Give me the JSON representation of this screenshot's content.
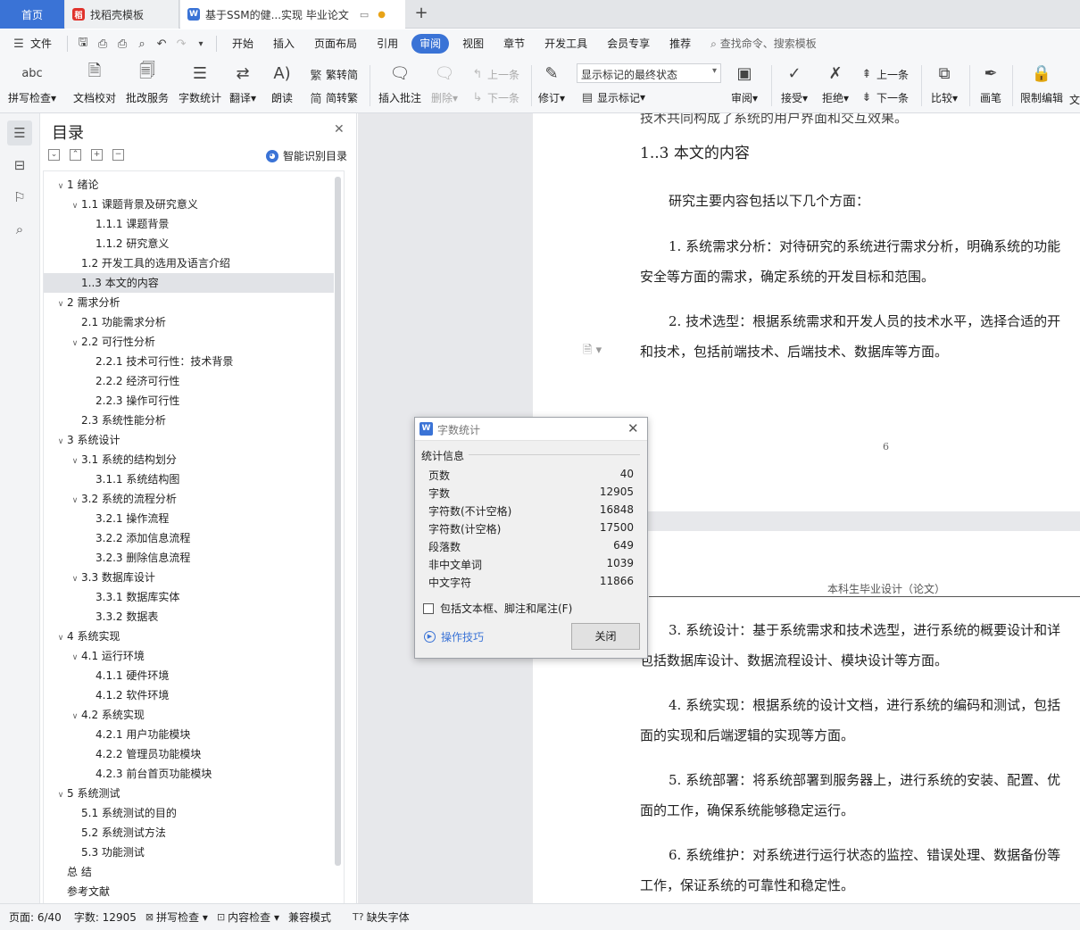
{
  "tabs": {
    "home": "首页",
    "template": "找稻壳模板",
    "document": "基于SSM的健...实现 毕业论文",
    "add": "+"
  },
  "menubar": {
    "file": "文件",
    "items": [
      "开始",
      "插入",
      "页面布局",
      "引用",
      "审阅",
      "视图",
      "章节",
      "开发工具",
      "会员专享",
      "推荐"
    ],
    "search": "查找命令、搜索模板"
  },
  "ribbon": {
    "spell_check": "拼写检查",
    "doc_proof": "文档校对",
    "batch_service": "批改服务",
    "word_count": "字数统计",
    "translate": "翻译",
    "read_aloud": "朗读",
    "trad_to_simp": "繁转简",
    "simp_to_trad": "简转繁",
    "insert_comment": "插入批注",
    "delete": "删除",
    "prev_comment": "上一条",
    "next_comment": "下一条",
    "track_changes": "修订",
    "markup_mode": "显示标记的最终状态",
    "show_markup": "显示标记",
    "review": "审阅",
    "accept": "接受",
    "reject": "拒绝",
    "prev_change": "上一条",
    "next_change": "下一条",
    "compare": "比较",
    "ink": "画笔",
    "restrict_editing": "限制编辑",
    "document_cut": "文"
  },
  "toc": {
    "title": "目录",
    "smart": "智能识别目录",
    "items": [
      {
        "label": "1  绪论",
        "level": 0,
        "caret": true
      },
      {
        "label": "1.1  课题背景及研究意义",
        "level": 1,
        "caret": true
      },
      {
        "label": "1.1.1  课题背景",
        "level": 2,
        "caret": false
      },
      {
        "label": "1.1.2  研究意义",
        "level": 2,
        "caret": false
      },
      {
        "label": "1.2  开发工具的选用及语言介绍",
        "level": 1,
        "caret": false
      },
      {
        "label": "1..3 本文的内容",
        "level": 1,
        "caret": false,
        "selected": true
      },
      {
        "label": "2  需求分析",
        "level": 0,
        "caret": true
      },
      {
        "label": "2.1  功能需求分析",
        "level": 1,
        "caret": false
      },
      {
        "label": "2.2  可行性分析",
        "level": 1,
        "caret": true
      },
      {
        "label": "2.2.1 技术可行性：技术背景",
        "level": 2,
        "caret": false
      },
      {
        "label": "2.2.2 经济可行性",
        "level": 2,
        "caret": false
      },
      {
        "label": "2.2.3 操作可行性",
        "level": 2,
        "caret": false
      },
      {
        "label": "2.3 系统性能分析",
        "level": 1,
        "caret": false
      },
      {
        "label": "3  系统设计",
        "level": 0,
        "caret": true
      },
      {
        "label": "3.1  系统的结构划分",
        "level": 1,
        "caret": true
      },
      {
        "label": "3.1.1  系统结构图",
        "level": 2,
        "caret": false
      },
      {
        "label": "3.2  系统的流程分析",
        "level": 1,
        "caret": true
      },
      {
        "label": "3.2.1 操作流程",
        "level": 2,
        "caret": false
      },
      {
        "label": "3.2.2 添加信息流程",
        "level": 2,
        "caret": false
      },
      {
        "label": "3.2.3 删除信息流程",
        "level": 2,
        "caret": false
      },
      {
        "label": "3.3 数据库设计",
        "level": 1,
        "caret": true
      },
      {
        "label": "3.3.1  数据库实体",
        "level": 2,
        "caret": false
      },
      {
        "label": "3.3.2 数据表",
        "level": 2,
        "caret": false
      },
      {
        "label": "4  系统实现",
        "level": 0,
        "caret": true
      },
      {
        "label": "4.1  运行环境",
        "level": 1,
        "caret": true
      },
      {
        "label": "4.1.1  硬件环境",
        "level": 2,
        "caret": false
      },
      {
        "label": "4.1.2  软件环境",
        "level": 2,
        "caret": false
      },
      {
        "label": "4.2  系统实现",
        "level": 1,
        "caret": true
      },
      {
        "label": "4.2.1 用户功能模块",
        "level": 2,
        "caret": false
      },
      {
        "label": "4.2.2 管理员功能模块",
        "level": 2,
        "caret": false
      },
      {
        "label": "4.2.3 前台首页功能模块",
        "level": 2,
        "caret": false
      },
      {
        "label": "5  系统测试",
        "level": 0,
        "caret": true
      },
      {
        "label": "5.1 系统测试的目的",
        "level": 1,
        "caret": false
      },
      {
        "label": "5.2 系统测试方法",
        "level": 1,
        "caret": false
      },
      {
        "label": "5.3 功能测试",
        "level": 1,
        "caret": false
      },
      {
        "label": "总  结",
        "level": 0,
        "caret": false
      },
      {
        "label": "参考文献",
        "level": 0,
        "caret": false
      }
    ]
  },
  "document": {
    "cut_line": "技术共同构成了系统的用户界面和交互效果。",
    "heading": "1..3 本文的内容",
    "intro": "研究主要内容包括以下几个方面：",
    "p1a": "1. 系统需求分析：对待研究的系统进行需求分析，明确系统的功能",
    "p1b": "安全等方面的需求，确定系统的开发目标和范围。",
    "p2a": "2. 技术选型：根据系统需求和开发人员的技术水平，选择合适的开",
    "p2b": "和技术，包括前端技术、后端技术、数据库等方面。",
    "page_number": "6",
    "page_header": "本科生毕业设计（论文）",
    "p3a": "3. 系统设计：基于系统需求和技术选型，进行系统的概要设计和详",
    "p3b": "包括数据库设计、数据流程设计、模块设计等方面。",
    "p4a": "4. 系统实现：根据系统的设计文档，进行系统的编码和测试，包括",
    "p4b": "面的实现和后端逻辑的实现等方面。",
    "p5a": "5. 系统部署：将系统部署到服务器上，进行系统的安装、配置、优",
    "p5b": "面的工作，确保系统能够稳定运行。",
    "p6a": "6. 系统维护：对系统进行运行状态的监控、错误处理、数据备份等",
    "p6b": "工作，保证系统的可靠性和稳定性。"
  },
  "dialog": {
    "title": "字数统计",
    "group": "统计信息",
    "stats": [
      {
        "label": "页数",
        "value": "40"
      },
      {
        "label": "字数",
        "value": "12905"
      },
      {
        "label": "字符数(不计空格)",
        "value": "16848"
      },
      {
        "label": "字符数(计空格)",
        "value": "17500"
      },
      {
        "label": "段落数",
        "value": "649"
      },
      {
        "label": "非中文单词",
        "value": "1039"
      },
      {
        "label": "中文字符",
        "value": "11866"
      }
    ],
    "include_label": "包括文本框、脚注和尾注(F)",
    "include_checked": false,
    "tips": "操作技巧",
    "close": "关闭"
  },
  "status": {
    "page": "页面: 6/40",
    "words": "字数: 12905",
    "spell": "拼写检查",
    "content_check": "内容检查",
    "compat": "兼容模式",
    "missing_font": "缺失字体"
  },
  "colors": {
    "accent": "#3a73d6",
    "selection": "#e1e3e7"
  }
}
